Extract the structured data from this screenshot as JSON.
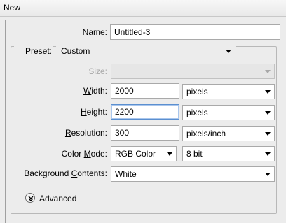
{
  "window": {
    "title": "New"
  },
  "name": {
    "label_ul": "N",
    "label_rest": "ame:",
    "value": "Untitled-3"
  },
  "preset": {
    "label_ul": "P",
    "label_rest": "reset:",
    "value": "Custom"
  },
  "size": {
    "label": "Size:",
    "value": ""
  },
  "width": {
    "label_ul": "W",
    "label_rest": "idth:",
    "value": "2000",
    "unit": "pixels"
  },
  "height": {
    "label_ul": "H",
    "label_rest": "eight:",
    "value": "2200",
    "unit": "pixels"
  },
  "resolution": {
    "label_ul": "R",
    "label_rest": "esolution:",
    "value": "300",
    "unit": "pixels/inch"
  },
  "color_mode": {
    "label_pre": "Color ",
    "label_ul": "M",
    "label_rest": "ode:",
    "value": "RGB Color",
    "depth": "8 bit"
  },
  "background": {
    "label_pre": "Background ",
    "label_ul": "C",
    "label_rest": "ontents:",
    "value": "White"
  },
  "advanced": {
    "label": "Advanced"
  }
}
